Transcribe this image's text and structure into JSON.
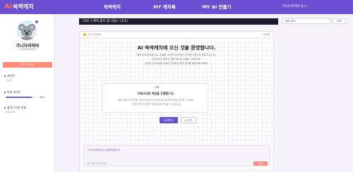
{
  "nav": {
    "brand_ai": "Ai",
    "brand_name": "쓱싹캐치",
    "links": [
      "쓱싹캐치",
      "MY 캐치톡",
      "MY AI 만들기"
    ],
    "user": "가니다라마바 님",
    "user_caret": "▾"
  },
  "profile": {
    "name": "가니다라마바",
    "sub": "인공지능캐릭터",
    "myai_button": "MY AI 관리"
  },
  "stats": [
    {
      "label": "포인트",
      "sub": "120P"
    },
    {
      "label": "미션 포인트",
      "sub": "",
      "percent": "85%",
      "percent_value": 0.85
    },
    {
      "label": "출석 / 미션 완료",
      "sub": "30일/28"
    }
  ],
  "thread": {
    "title": "[35] 스케치 같이 할 사람~ (1/1)"
  },
  "panel": {
    "header_left": "가니다라마바",
    "header_right": "대기중",
    "welcome_title": "AI 쓱싹캐치에 오신 것을 환영합니다.",
    "welcome_lines": [
      "출제 주제 힌트를 보고 그림을 그리면 인공지능이 무엇을 그렸는지 맞춰 드립니다.",
      "인공지능이 맞히기 전에 제시된 그림을 그려보세요.",
      "나만의 인공지능을 만들어 친구들과 함께 게임을 플레이해 보세요."
    ],
    "rule_chip": "시작",
    "rule_title": "카테고리로 게임을 진행합니다.",
    "rule_lines": [
      "해당 카테고리 관련된 제시어 중 하나가 랜덤으로 제시되면 해당 단어를 그리세요.",
      "• 정답 맞히기 라운드 카테고리를 선택할 수 있습니다."
    ],
    "start_button": "시작하기",
    "next_button": "나가기"
  },
  "chat": {
    "status": "가니다라마바님이 입장하였습니다.",
    "placeholder": "메시지를 입력하세요.",
    "send_button": "전송"
  },
  "right": {
    "select_value": "채팅 필터",
    "select_right": "선택"
  }
}
